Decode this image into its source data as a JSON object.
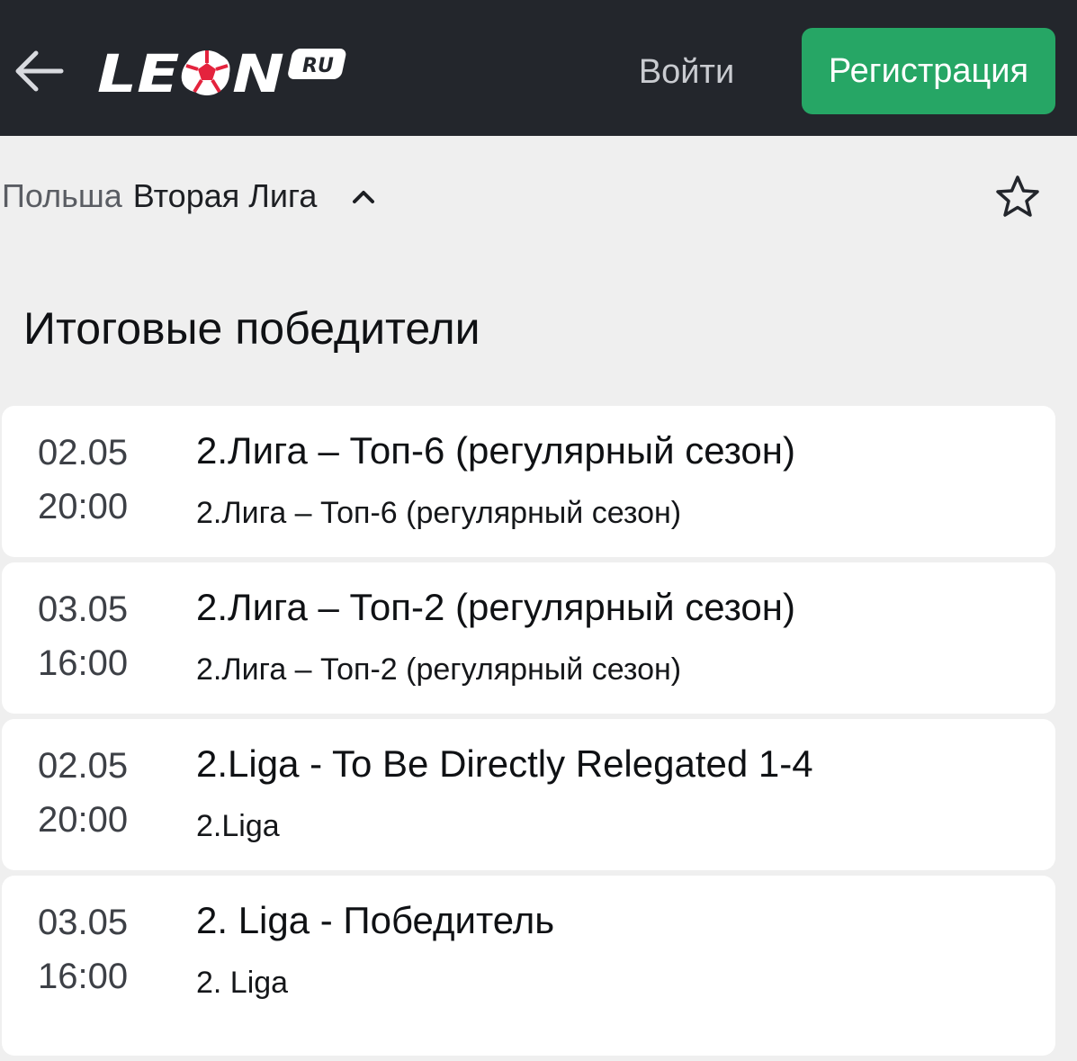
{
  "header": {
    "logo_text": "LEON",
    "logo_badge": "RU",
    "login_label": "Войти",
    "register_label": "Регистрация",
    "colors": {
      "header_bg": "#23262c",
      "register_bg": "#26a665",
      "logo_ball": "#e4233d"
    }
  },
  "breadcrumb": {
    "country": "Польша",
    "league": "Вторая Лига"
  },
  "section_title": "Итоговые победители",
  "events": [
    {
      "date": "02.05",
      "time": "20:00",
      "name": "2.Лига – Топ-6 (регулярный сезон)",
      "subtitle": "2.Лига – Топ-6 (регулярный сезон)"
    },
    {
      "date": "03.05",
      "time": "16:00",
      "name": "2.Лига – Топ-2 (регулярный сезон)",
      "subtitle": "2.Лига – Топ-2 (регулярный сезон)"
    },
    {
      "date": "02.05",
      "time": "20:00",
      "name": "2.Liga - To Be Directly Relegated 1-4",
      "subtitle": "2.Liga"
    },
    {
      "date": "03.05",
      "time": "16:00",
      "name": "2. Liga - Победитель",
      "subtitle": "2. Liga"
    }
  ],
  "icons": {
    "back": "arrow-left-icon",
    "chevron": "chevron-up-icon",
    "favorite": "star-outline-icon"
  }
}
